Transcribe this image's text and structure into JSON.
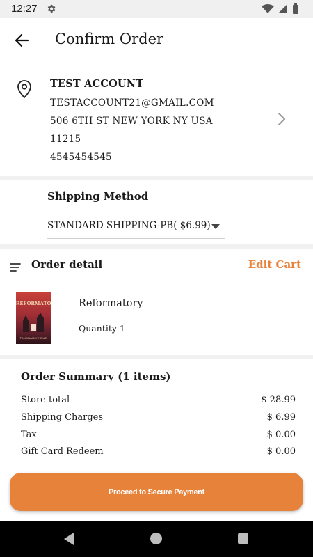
{
  "status_bar": {
    "time": "12:27"
  },
  "header": {
    "title": "Confirm Order"
  },
  "address": {
    "name": "TEST ACCOUNT",
    "email": "TESTACCOUNT21@GMAIL.COM",
    "street": "506 6TH ST NEW YORK NY USA",
    "zip": "11215",
    "phone": "4545454545"
  },
  "shipping": {
    "title": "Shipping Method",
    "selected": "STANDARD SHIPPING-PB( $6.99)"
  },
  "order_detail": {
    "title": "Order detail",
    "edit_label": "Edit Cart",
    "items": [
      {
        "name": "Reformatory",
        "quantity": "Quantity 1",
        "cover_title": "REFORMATORY",
        "cover_author": "TANANARIVE DUE"
      }
    ]
  },
  "summary": {
    "title": "Order Summary (1 items)",
    "rows": [
      {
        "label": "Store total",
        "value": "$ 28.99"
      },
      {
        "label": "Shipping Charges",
        "value": "$ 6.99"
      },
      {
        "label": "Tax",
        "value": "$ 0.00"
      },
      {
        "label": "Gift Card Redeem",
        "value": "$ 0.00"
      }
    ]
  },
  "actions": {
    "pay_label": "Proceed to Secure Payment"
  },
  "colors": {
    "accent": "#e6823a",
    "status_bar": "#f0f0f0",
    "divider": "#f1f1f1",
    "nav_bar": "#000000"
  },
  "icons": [
    "settings-gear-icon",
    "wifi-icon",
    "signal-icon",
    "battery-icon",
    "back-arrow-icon",
    "location-pin-icon",
    "chevron-right-icon",
    "dropdown-caret-icon",
    "list-icon",
    "nav-back-icon",
    "nav-home-icon",
    "nav-recents-icon"
  ]
}
